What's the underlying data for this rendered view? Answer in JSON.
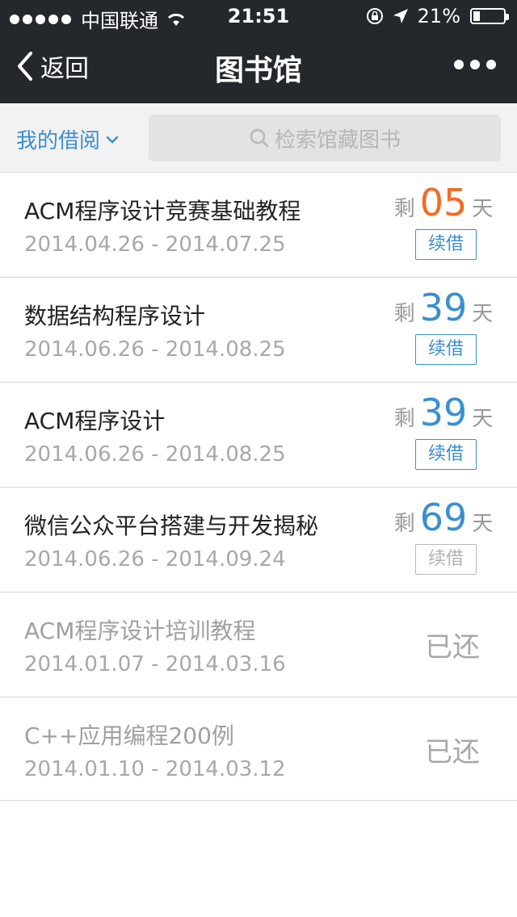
{
  "status_bar": {
    "carrier": "中国联通",
    "time": "21:51",
    "battery_percent": "21%",
    "battery_level": 0.21
  },
  "nav": {
    "back_label": "返回",
    "title": "图书馆"
  },
  "filter": {
    "dropdown_label": "我的借阅",
    "search_placeholder": "检索馆藏图书"
  },
  "colors": {
    "accent_blue": "#3a8fd0",
    "warning_orange": "#f26c22",
    "nav_background": "#24282c"
  },
  "items": [
    {
      "title": "ACM程序设计竞赛基础教程",
      "dates": "2014.04.26 - 2014.07.25",
      "remain_label": "剩",
      "remain_days": "05",
      "unit": "天",
      "renew": "续借"
    },
    {
      "title": "数据结构程序设计",
      "dates": "2014.06.26 - 2014.08.25",
      "remain_label": "剩",
      "remain_days": "39",
      "unit": "天",
      "renew": "续借"
    },
    {
      "title": "ACM程序设计",
      "dates": "2014.06.26 - 2014.08.25",
      "remain_label": "剩",
      "remain_days": "39",
      "unit": "天",
      "renew": "续借"
    },
    {
      "title": "微信公众平台搭建与开发揭秘",
      "dates": "2014.06.26 - 2014.09.24",
      "remain_label": "剩",
      "remain_days": "69",
      "unit": "天",
      "renew": "续借"
    },
    {
      "title": "ACM程序设计培训教程",
      "dates": "2014.01.07 - 2014.03.16",
      "status": "已还"
    },
    {
      "title": "C++应用编程200例",
      "dates": "2014.01.10 - 2014.03.12",
      "status": "已还"
    }
  ]
}
